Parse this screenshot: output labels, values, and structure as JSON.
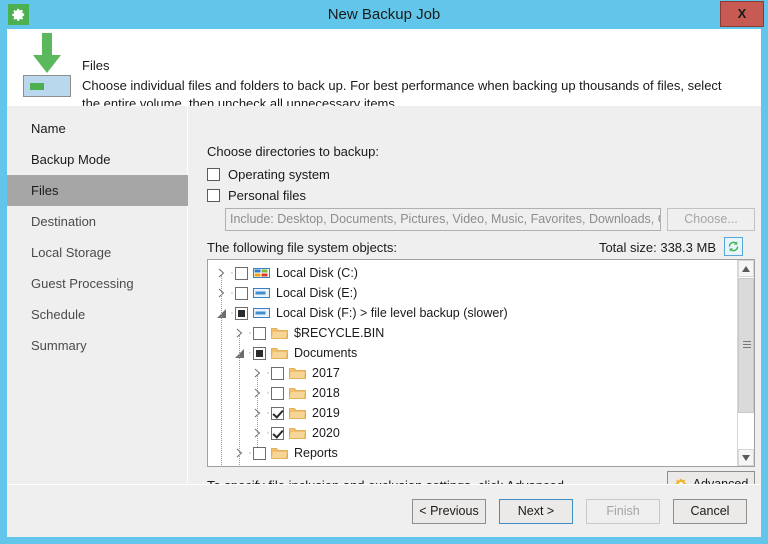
{
  "window": {
    "title": "New Backup Job",
    "title_icon": "gear-icon",
    "close_label": "X",
    "accent_color": "#62c6ea",
    "close_color": "#c75b54"
  },
  "header": {
    "icon": "download-to-drive-icon",
    "title": "Files",
    "description": "Choose individual files and folders to back up. For best performance when backing up thousands of files, select the entire volume, then uncheck all unnecessary items."
  },
  "sidebar": {
    "items": [
      {
        "label": "Name",
        "state": "visited"
      },
      {
        "label": "Backup Mode",
        "state": "visited"
      },
      {
        "label": "Files",
        "state": "active"
      },
      {
        "label": "Destination",
        "state": "pending"
      },
      {
        "label": "Local Storage",
        "state": "pending"
      },
      {
        "label": "Guest Processing",
        "state": "pending"
      },
      {
        "label": "Schedule",
        "state": "pending"
      },
      {
        "label": "Summary",
        "state": "pending"
      }
    ]
  },
  "main": {
    "choose_dirs_label": "Choose directories to backup:",
    "checkboxes": [
      {
        "label": "Operating system",
        "checked": false
      },
      {
        "label": "Personal files",
        "checked": false
      }
    ],
    "include_field": {
      "value": "Include: Desktop, Documents, Pictures, Video, Music, Favorites, Downloads, Other",
      "disabled": true
    },
    "choose_button": {
      "label": "Choose...",
      "disabled": true
    },
    "objects_label": "The following file system objects:",
    "total_size_label": "Total size:  338.3 MB",
    "refresh_icon": "refresh-icon",
    "advanced_note": "To specify file inclusion and exclusion settings, click Advanced",
    "advanced_button": {
      "label": "Advanced",
      "icon": "gear-icon"
    }
  },
  "tree": {
    "rows": [
      {
        "indent": 0,
        "expander": "collapsed",
        "check": "unchecked",
        "icon": "windows-drive-icon",
        "label": "Local Disk (C:)"
      },
      {
        "indent": 0,
        "expander": "collapsed",
        "check": "unchecked",
        "icon": "drive-icon",
        "label": "Local Disk (E:)"
      },
      {
        "indent": 0,
        "expander": "expanded",
        "check": "partial",
        "icon": "drive-icon",
        "label": "Local Disk (F:) > file level backup (slower)"
      },
      {
        "indent": 1,
        "expander": "collapsed",
        "check": "unchecked",
        "icon": "folder-icon",
        "label": "$RECYCLE.BIN"
      },
      {
        "indent": 1,
        "expander": "expanded",
        "check": "partial",
        "icon": "folder-icon",
        "label": "Documents"
      },
      {
        "indent": 2,
        "expander": "collapsed",
        "check": "unchecked",
        "icon": "folder-icon",
        "label": "2017"
      },
      {
        "indent": 2,
        "expander": "collapsed",
        "check": "unchecked",
        "icon": "folder-icon",
        "label": "2018"
      },
      {
        "indent": 2,
        "expander": "collapsed",
        "check": "checked",
        "icon": "folder-icon",
        "label": "2019"
      },
      {
        "indent": 2,
        "expander": "collapsed",
        "check": "checked",
        "icon": "folder-icon",
        "label": "2020"
      },
      {
        "indent": 1,
        "expander": "collapsed",
        "check": "unchecked",
        "icon": "folder-icon",
        "label": "Reports"
      },
      {
        "indent": 1,
        "expander": "collapsed",
        "check": "unchecked",
        "icon": "folder-icon",
        "label": ""
      }
    ]
  },
  "footer": {
    "buttons": [
      {
        "label": "< Previous",
        "state": "normal"
      },
      {
        "label": "Next >",
        "state": "focus"
      },
      {
        "label": "Finish",
        "state": "disabled"
      },
      {
        "label": "Cancel",
        "state": "normal"
      }
    ]
  }
}
